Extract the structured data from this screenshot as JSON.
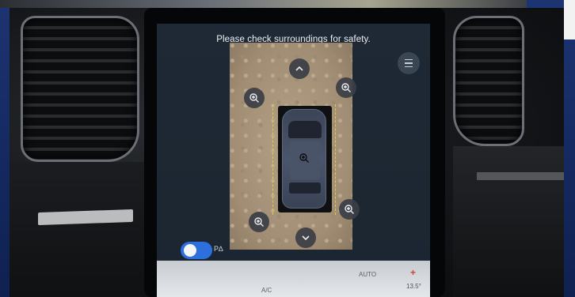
{
  "screen": {
    "title": "Please check surroundings for safety.",
    "menu_icon": "menu-lines-icon"
  },
  "camera": {
    "buttons": [
      {
        "name": "camera-front-button",
        "icon": "chevron-up-icon"
      },
      {
        "name": "camera-zoom-front-left-button",
        "icon": "zoom-in-icon"
      },
      {
        "name": "camera-zoom-front-right-button",
        "icon": "zoom-in-icon"
      },
      {
        "name": "camera-zoom-rear-left-button",
        "icon": "zoom-in-icon"
      },
      {
        "name": "camera-zoom-rear-right-button",
        "icon": "zoom-in-icon"
      },
      {
        "name": "camera-rear-button",
        "icon": "chevron-down-icon"
      },
      {
        "name": "camera-zoom-center-button",
        "icon": "zoom-in-icon"
      }
    ],
    "guide_color": "#d8d23a"
  },
  "park_assist": {
    "label": "P∆",
    "toggle_on": true,
    "toggle_color": "#2d6fdc"
  },
  "climate": {
    "auto_label": "AUTO",
    "ac_label": "A/C",
    "temp_label": "13.5°",
    "plus_label": "+"
  }
}
